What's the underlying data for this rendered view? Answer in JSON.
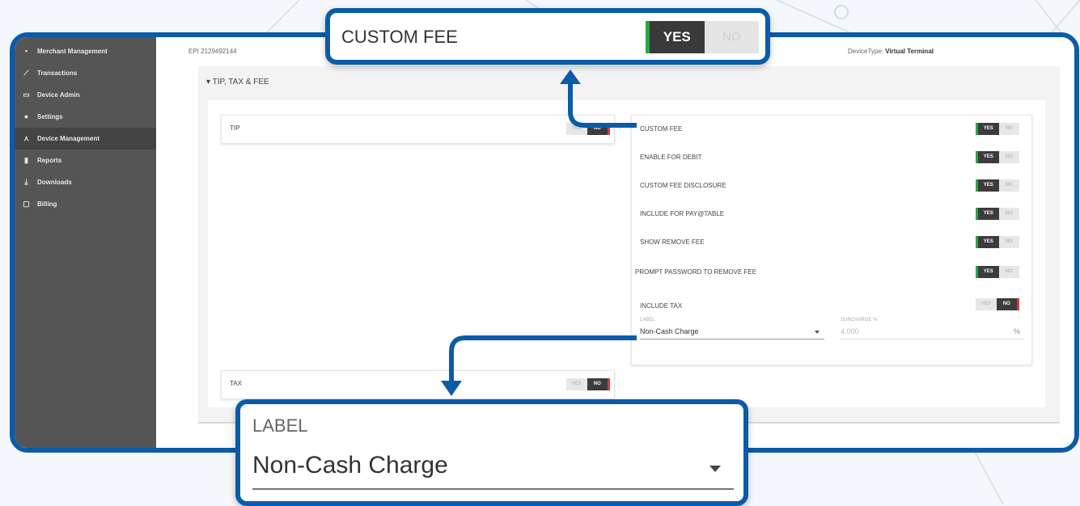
{
  "sidebar": {
    "items": [
      {
        "label": "Merchant Management",
        "icon": "building-icon"
      },
      {
        "label": "Transactions",
        "icon": "chart-line-icon"
      },
      {
        "label": "Device Admin",
        "icon": "device-icon"
      },
      {
        "label": "Settings",
        "icon": "gear-icon"
      },
      {
        "label": "Device Management",
        "icon": "network-icon"
      },
      {
        "label": "Reports",
        "icon": "document-icon"
      },
      {
        "label": "Downloads",
        "icon": "download-icon"
      },
      {
        "label": "Billing",
        "icon": "billing-icon"
      }
    ],
    "active_index": 4
  },
  "header": {
    "epi": "EPI 2129492144",
    "device_type_label": "DeviceType:",
    "device_type_value": "Virtual Terminal"
  },
  "section": {
    "title": "TIP, TAX & FEE",
    "tip": {
      "label": "TIP",
      "yes": "YES",
      "no": "NO",
      "value": "NO"
    },
    "tax": {
      "label": "TAX",
      "yes": "YES",
      "no": "NO",
      "value": "NO"
    },
    "fee_settings": [
      {
        "label": "CUSTOM FEE",
        "yes": "YES",
        "no": "NO",
        "value": "YES"
      },
      {
        "label": "ENABLE FOR DEBIT",
        "yes": "YES",
        "no": "NO",
        "value": "YES"
      },
      {
        "label": "CUSTOM FEE DISCLOSURE",
        "yes": "YES",
        "no": "NO",
        "value": "YES"
      },
      {
        "label": "INCLUDE FOR PAY@TABLE",
        "yes": "YES",
        "no": "NO",
        "value": "YES"
      },
      {
        "label": "SHOW REMOVE FEE",
        "yes": "YES",
        "no": "NO",
        "value": "YES"
      },
      {
        "label": "PROMPT PASSWORD TO REMOVE FEE",
        "yes": "YES",
        "no": "NO",
        "value": "YES"
      },
      {
        "label": "INCLUDE TAX",
        "yes": "YES",
        "no": "NO",
        "value": "NO"
      }
    ],
    "label_field": {
      "label": "LABEL",
      "value": "Non-Cash Charge"
    },
    "surcharge_field": {
      "label": "SURCHARGE %",
      "value": "4.000",
      "unit": "%"
    }
  },
  "zoom_top": {
    "title": "CUSTOM FEE",
    "yes": "YES",
    "no": "NO"
  },
  "zoom_bottom": {
    "label": "LABEL",
    "value": "Non-Cash Charge"
  },
  "colors": {
    "accent_blue": "#0b5ca8",
    "toggle_yes": "#28a745",
    "toggle_no": "#dc3545",
    "sidebar": "#555555"
  }
}
